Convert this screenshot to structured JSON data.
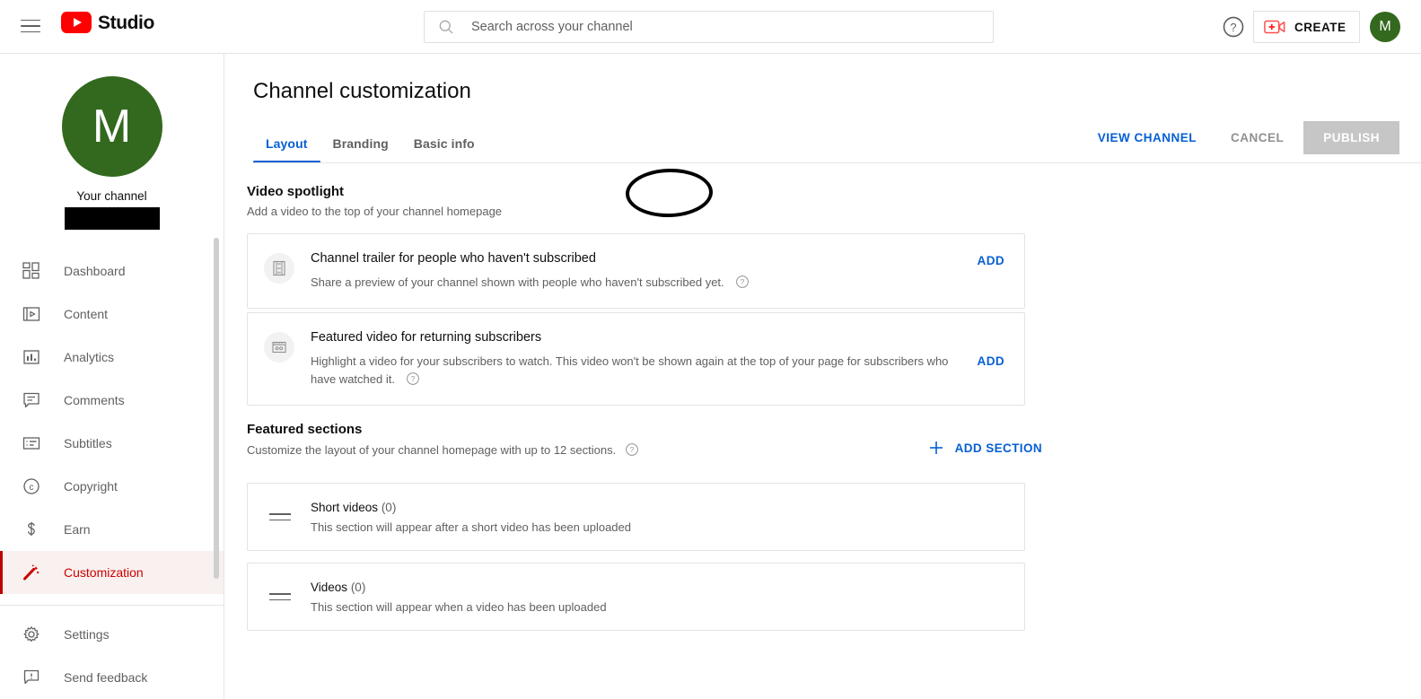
{
  "header": {
    "menu_icon": "hamburger-icon",
    "brand": "Studio",
    "search": {
      "placeholder": "Search across your channel",
      "value": "",
      "icon": "search-icon"
    },
    "help_icon": "help-circle-icon",
    "create_label": "CREATE",
    "create_icon": "video-camera-plus-icon",
    "avatar_letter": "M",
    "avatar_color": "#33691e"
  },
  "sidebar": {
    "avatar_letter": "M",
    "avatar_color": "#33691e",
    "your_channel_label": "Your channel",
    "channel_name_redacted": "",
    "items": [
      {
        "label": "Dashboard",
        "icon": "dashboard-grid-icon",
        "active": false
      },
      {
        "label": "Content",
        "icon": "video-frame-icon",
        "active": false
      },
      {
        "label": "Analytics",
        "icon": "bar-chart-icon",
        "active": false
      },
      {
        "label": "Comments",
        "icon": "comment-bubble-icon",
        "active": false
      },
      {
        "label": "Subtitles",
        "icon": "subtitles-icon",
        "active": false
      },
      {
        "label": "Copyright",
        "icon": "copyright-icon",
        "active": false
      },
      {
        "label": "Earn",
        "icon": "dollar-sign-icon",
        "active": false
      },
      {
        "label": "Customization",
        "icon": "magic-wand-icon",
        "active": true
      }
    ],
    "footer_items": [
      {
        "label": "Settings",
        "icon": "gear-icon"
      },
      {
        "label": "Send feedback",
        "icon": "feedback-exclamation-icon"
      }
    ],
    "active_color": "#cc0000"
  },
  "main": {
    "page_title": "Channel customization",
    "tabs": [
      {
        "label": "Layout",
        "active": true
      },
      {
        "label": "Branding",
        "active": false
      },
      {
        "label": "Basic info",
        "active": false,
        "annotated": true
      }
    ],
    "annotation": {
      "shape": "hand-drawn-ellipse",
      "target": "Basic info",
      "color": "#000000"
    },
    "actions": {
      "view_channel": "VIEW CHANNEL",
      "cancel": "CANCEL",
      "publish": "PUBLISH",
      "publish_disabled": true
    },
    "video_spotlight": {
      "title": "Video spotlight",
      "subtitle": "Add a video to the top of your channel homepage",
      "cards": [
        {
          "icon": "film-strip-icon",
          "title": "Channel trailer for people who haven't subscribed",
          "description": "Share a preview of your channel shown with people who haven't subscribed yet.",
          "help_icon": "help-circle-icon",
          "action": "ADD"
        },
        {
          "icon": "featured-video-icon",
          "title": "Featured video for returning subscribers",
          "description": "Highlight a video for your subscribers to watch. This video won't be shown again at the top of your page for subscribers who have watched it.",
          "help_icon": "help-circle-icon",
          "action": "ADD"
        }
      ]
    },
    "featured_sections": {
      "title": "Featured sections",
      "subtitle": "Customize the layout of your channel homepage with up to 12 sections.",
      "help_icon": "help-circle-icon",
      "add_section_label": "ADD SECTION",
      "add_section_icon": "plus-icon",
      "rows": [
        {
          "drag_icon": "drag-handle-icon",
          "title": "Short videos",
          "count": "(0)",
          "description": "This section will appear after a short video has been uploaded"
        },
        {
          "drag_icon": "drag-handle-icon",
          "title": "Videos",
          "count": "(0)",
          "description": "This section will appear when a video has been uploaded"
        }
      ]
    }
  },
  "colors": {
    "accent_blue": "#065fd4",
    "youtube_red": "#ff0000",
    "active_red": "#cc0000",
    "disabled_grey": "#c6c6c6"
  }
}
